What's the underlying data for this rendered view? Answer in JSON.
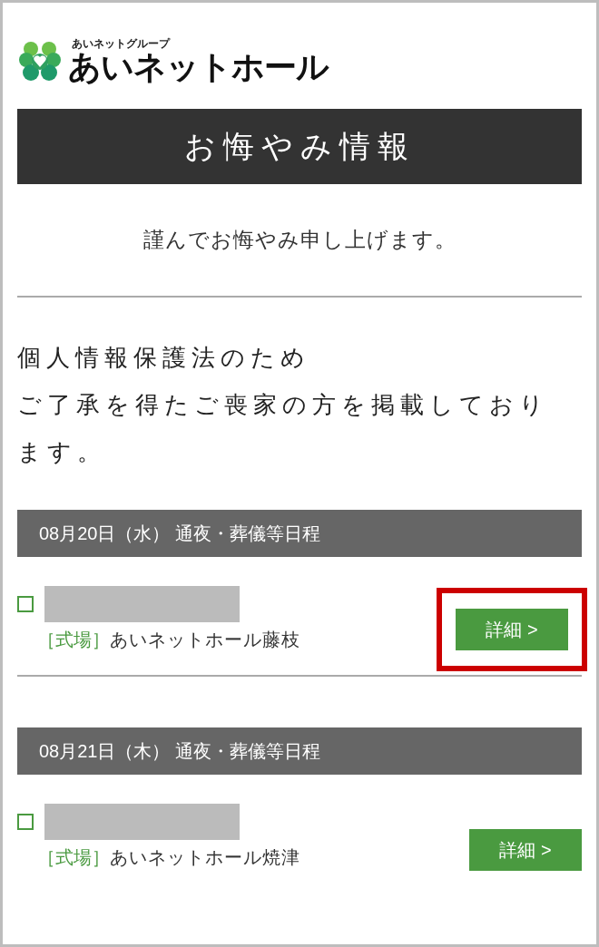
{
  "logo": {
    "group": "あいネットグループ",
    "name": "あいネットホール"
  },
  "title": "お悔やみ情報",
  "condolence": "謹んでお悔やみ申し上げます。",
  "notice": [
    "個人情報保護法のため",
    "ご了承を得たご喪家の方を掲載しております。"
  ],
  "days": [
    {
      "header": "08月20日（水） 通夜・葬儀等日程",
      "entries": [
        {
          "venue_label": "［式場］",
          "venue": "あいネットホール藤枝",
          "button": "詳細 >",
          "highlighted": true
        }
      ]
    },
    {
      "header": "08月21日（木） 通夜・葬儀等日程",
      "entries": [
        {
          "venue_label": "［式場］",
          "venue": "あいネットホール焼津",
          "button": "詳細 >",
          "highlighted": false
        }
      ]
    }
  ]
}
